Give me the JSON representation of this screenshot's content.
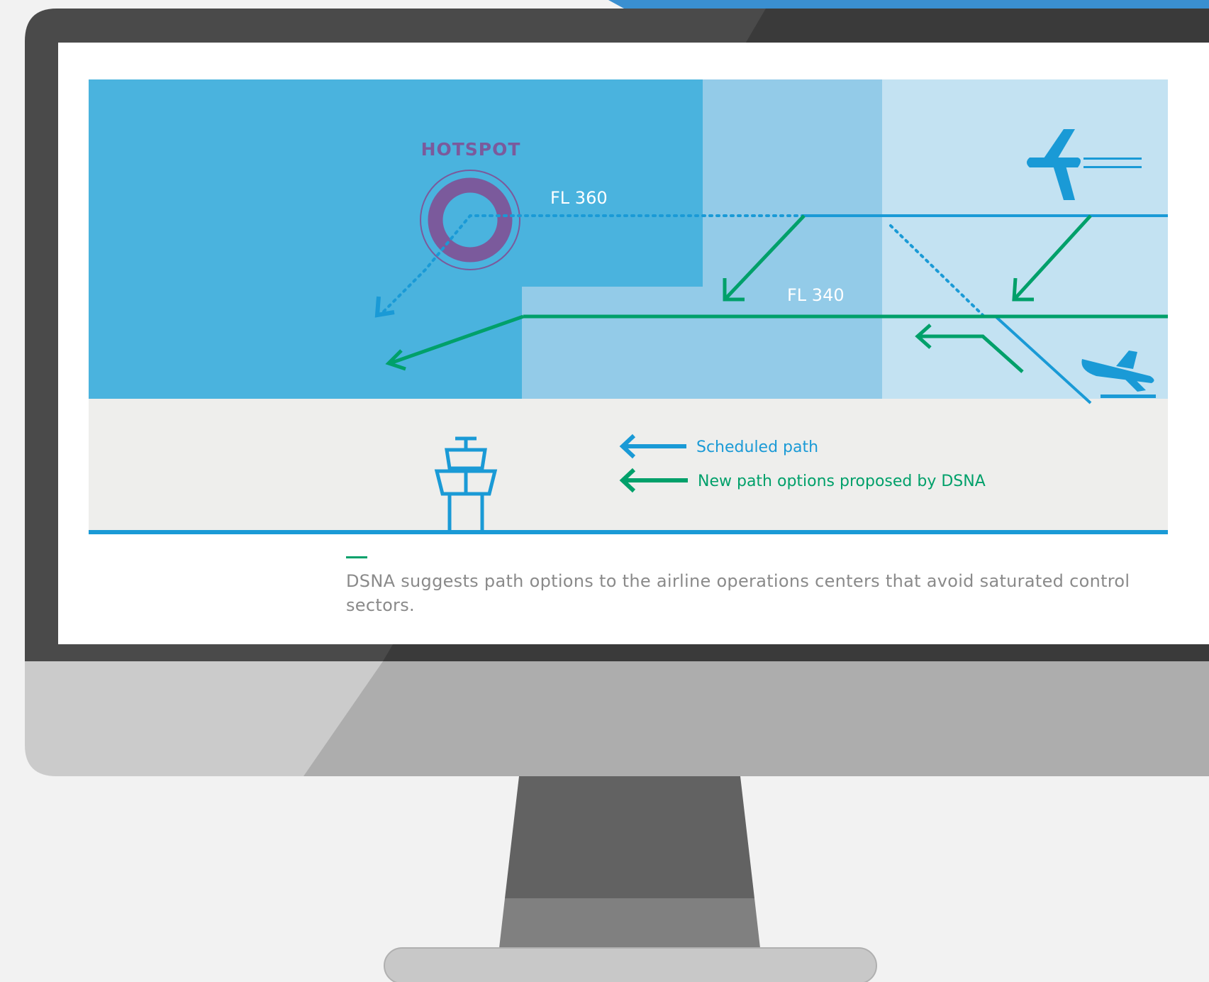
{
  "diagram": {
    "hotspot_label": "HOTSPOT",
    "fl_upper_label": "FL 360",
    "fl_lower_label": "FL 340",
    "legend": {
      "scheduled_label": "Scheduled path",
      "new_label": "New path options proposed by DSNA"
    },
    "caption": "DSNA suggests path options to the airline operations centers that avoid saturated control sectors."
  },
  "colors": {
    "scheduled_blue": "#1a9ad6",
    "new_green": "#00a06a",
    "hotspot_purple": "#7b5a9c",
    "sector_dark": "#4ab3de",
    "sector_mid": "#93cbe8",
    "sector_light": "#c3e2f2",
    "ground": "#eeeeec"
  },
  "icons": [
    "airplane-cruise-icon",
    "airplane-landing-icon",
    "control-tower-icon",
    "arrow-left-icon"
  ]
}
